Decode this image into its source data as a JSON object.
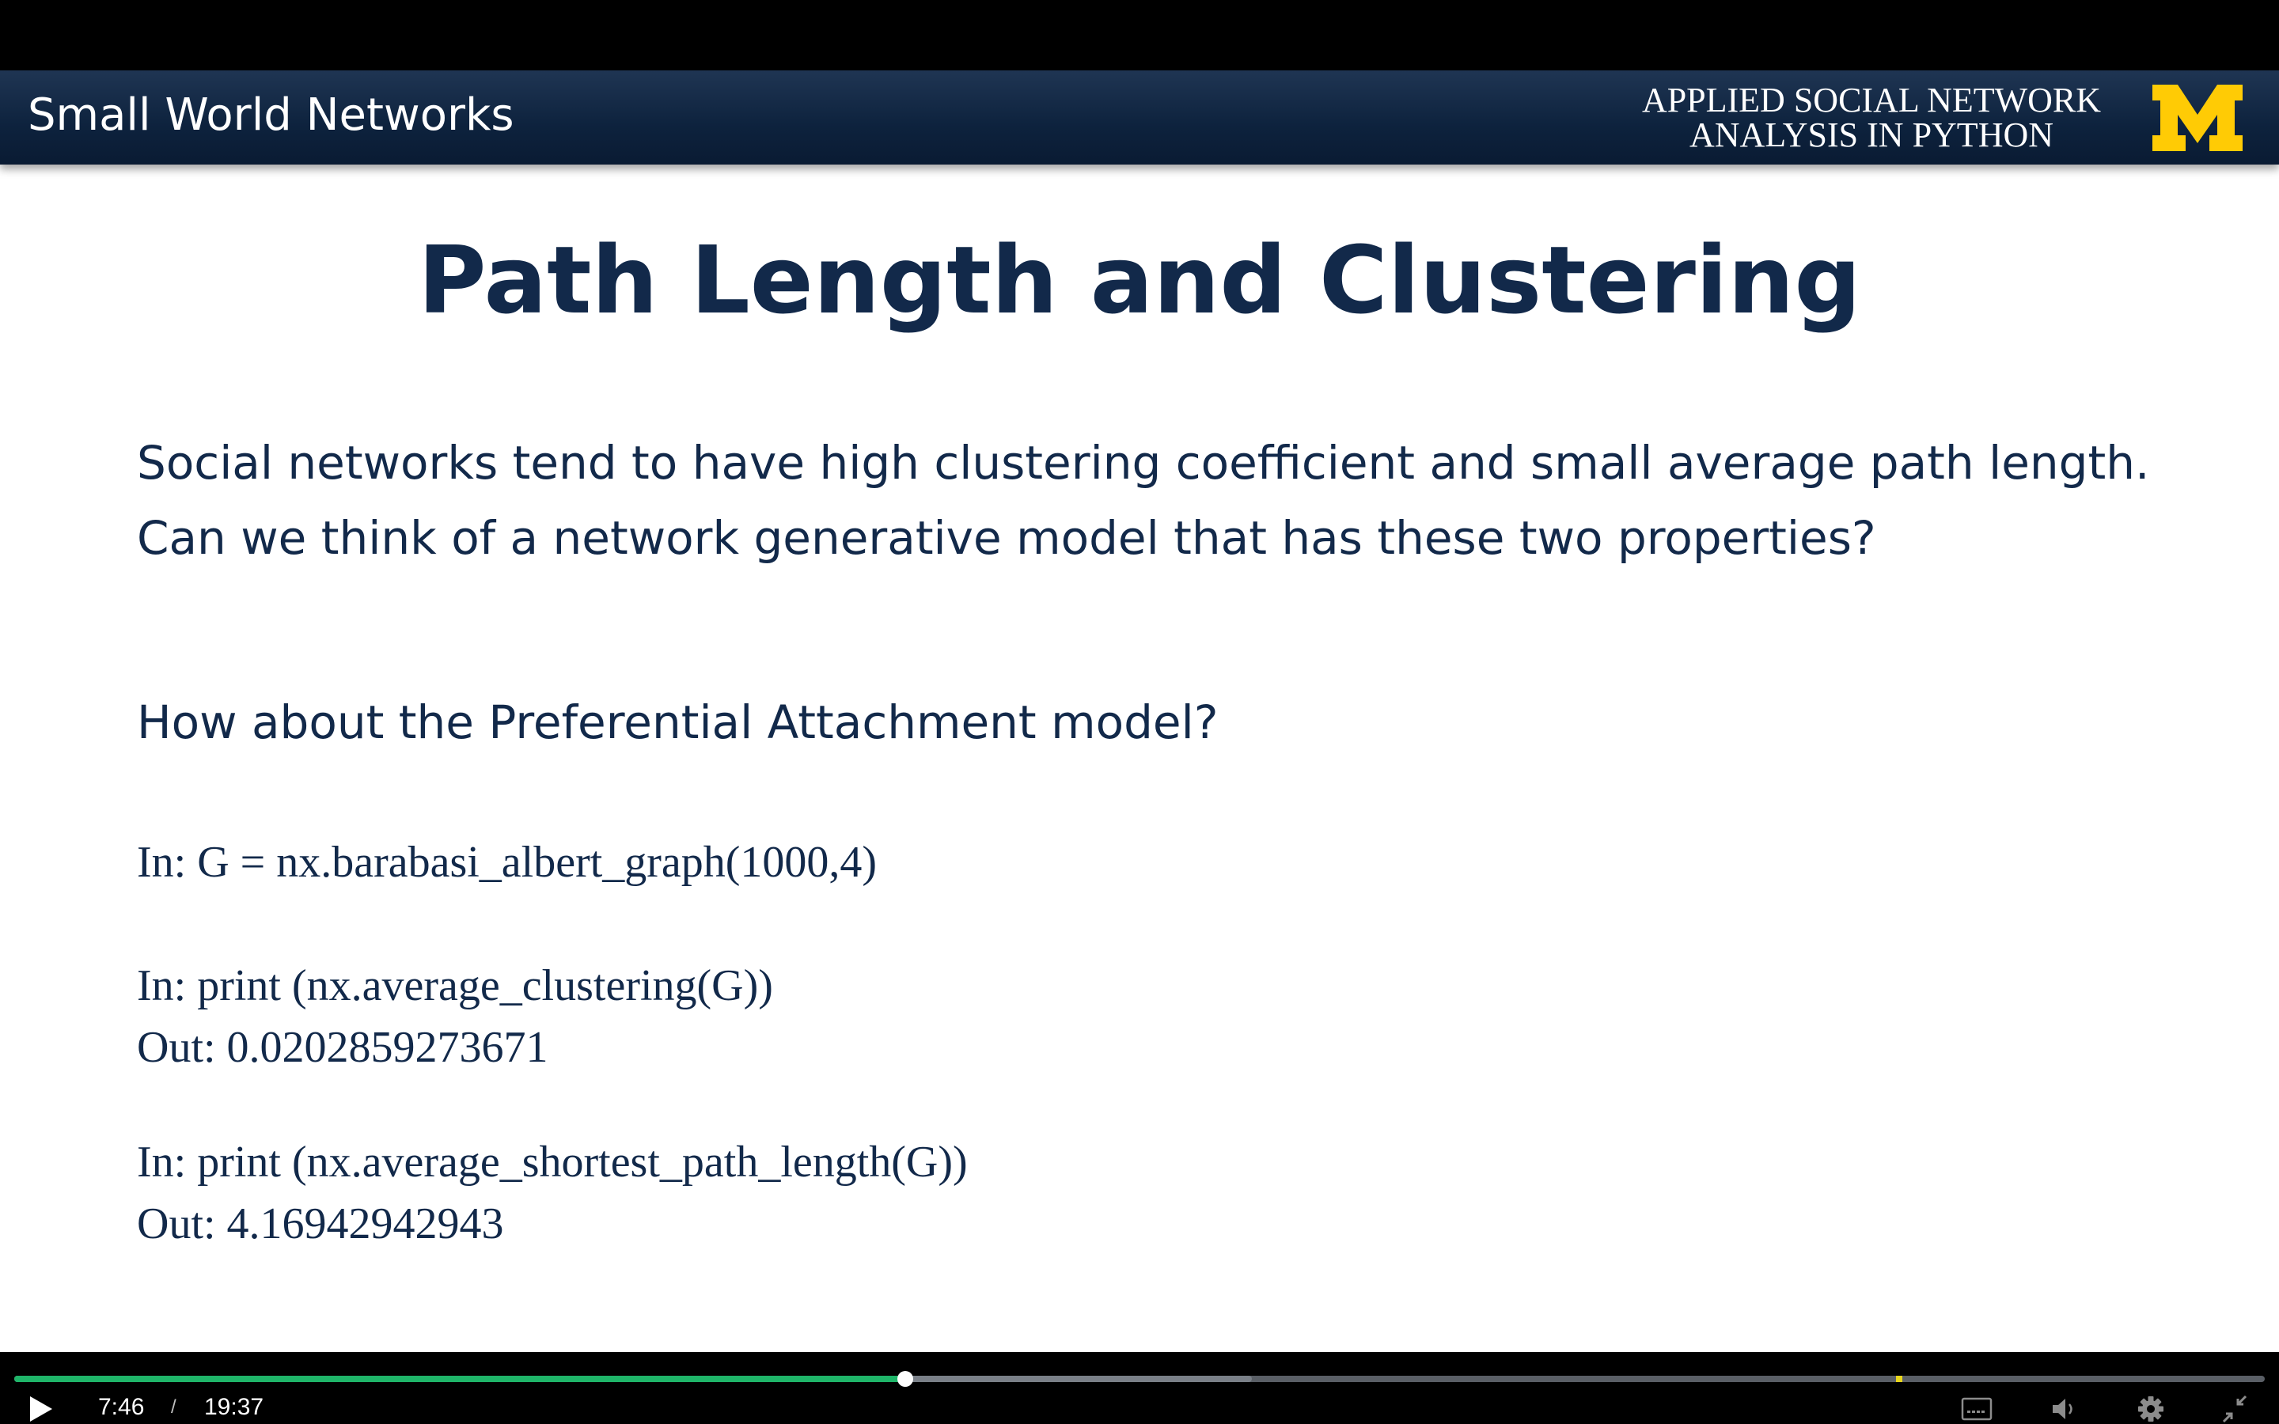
{
  "banner": {
    "lecture_title": "Small World Networks",
    "course_line1": "APPLIED SOCIAL NETWORK",
    "course_line2": "ANALYSIS IN PYTHON",
    "logo_color": "#ffcb05"
  },
  "slide": {
    "title": "Path Length and Clustering",
    "paragraph_line1": "Social networks tend to have high clustering coefficient and small average path length.",
    "paragraph_line2": "Can we think of a network generative model that has these two properties?",
    "question": "How about the Preferential Attachment model?",
    "code": {
      "line1": "In: G = nx.barabasi_albert_graph(1000,4)",
      "line2": "In: print (nx.average_clustering(G))",
      "line3": "Out: 0.0202859273671",
      "line4": "In: print (nx.average_shortest_path_length(G))",
      "line5": "Out: 4.16942942943"
    }
  },
  "player": {
    "current_time": "7:46",
    "separator": "/",
    "duration": "19:37",
    "progress_fraction": 0.396,
    "buffered_fraction": 0.55,
    "cue_marker_fraction": 0.836,
    "played_color": "#1fb569",
    "icons": {
      "play": "play-icon",
      "captions": "captions-icon",
      "volume": "volume-icon",
      "settings": "gear-icon",
      "fullscreen": "exit-fullscreen-icon"
    }
  }
}
